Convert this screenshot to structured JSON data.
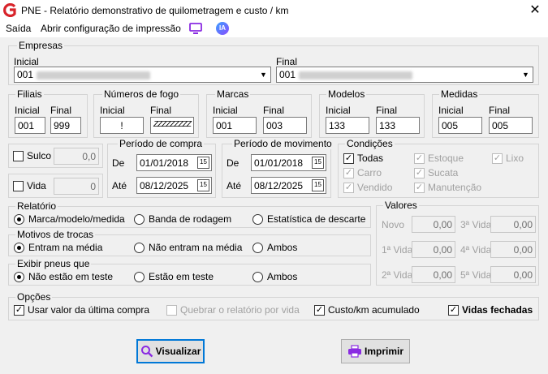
{
  "window": {
    "title": "PNE - Relatório demonstrativo de quilometragem e custo / km",
    "close_glyph": "✕"
  },
  "menu": {
    "saida": "Saída",
    "abrir": "Abrir configuração de impressão",
    "ia": "IA"
  },
  "empresas": {
    "legend": "Empresas",
    "inicial_label": "Inicial",
    "final_label": "Final",
    "inicial_value": "001",
    "final_value": "001"
  },
  "filiais": {
    "legend": "Filiais",
    "inicial_label": "Inicial",
    "final_label": "Final",
    "inicial_value": "001",
    "final_value": "999"
  },
  "fogo": {
    "legend": "Números de fogo",
    "inicial_label": "Inicial",
    "final_label": "Final",
    "inicial_value": "!",
    "final_value": "ZZZZZZZZZ"
  },
  "marcas": {
    "legend": "Marcas",
    "inicial_label": "Inicial",
    "final_label": "Final",
    "inicial_value": "001",
    "final_value": "003"
  },
  "modelos": {
    "legend": "Modelos",
    "inicial_label": "Inicial",
    "final_label": "Final",
    "inicial_value": "133",
    "final_value": "133"
  },
  "medidas": {
    "legend": "Medidas",
    "inicial_label": "Inicial",
    "final_label": "Final",
    "inicial_value": "005",
    "final_value": "005"
  },
  "sulco": {
    "label": "Sulco",
    "value": "0,0"
  },
  "vida": {
    "label": "Vida",
    "value": "0"
  },
  "periodo_compra": {
    "legend": "Período de compra",
    "de_label": "De",
    "ate_label": "Até",
    "de_value": "01/01/2018",
    "ate_value": "08/12/2025",
    "cal": "15"
  },
  "periodo_movimento": {
    "legend": "Período de movimento",
    "de_label": "De",
    "ate_label": "Até",
    "de_value": "01/01/2018",
    "ate_value": "08/12/2025",
    "cal": "15"
  },
  "condicoes": {
    "legend": "Condições",
    "todas": "Todas",
    "estoque": "Estoque",
    "lixo": "Lixo",
    "carro": "Carro",
    "sucata": "Sucata",
    "vendido": "Vendido",
    "manutencao": "Manutenção",
    "check": "✓"
  },
  "relatorio": {
    "legend": "Relatório",
    "opt1": "Marca/modelo/medida",
    "opt2": "Banda de rodagem",
    "opt3": "Estatística de descarte"
  },
  "motivos": {
    "legend": "Motivos de trocas",
    "opt1": "Entram na média",
    "opt2": "Não entram na média",
    "opt3": "Ambos"
  },
  "exibir": {
    "legend": "Exibir pneus que",
    "opt1": "Não estão em teste",
    "opt2": "Estão em teste",
    "opt3": "Ambos"
  },
  "valores": {
    "legend": "Valores",
    "novo": "Novo",
    "v3": "3ª Vida",
    "v1": "1ª Vida",
    "v4": "4ª Vida",
    "v2": "2ª Vida",
    "v5": "5ª Vida",
    "amount": "0,00"
  },
  "opcoes": {
    "legend": "Opções",
    "opt1": "Usar valor da última compra",
    "opt2": "Quebrar o relatório por vida",
    "opt3": "Custo/km acumulado",
    "opt4": "Vidas fechadas"
  },
  "buttons": {
    "visualizar": "Visualizar",
    "imprimir": "Imprimir"
  }
}
